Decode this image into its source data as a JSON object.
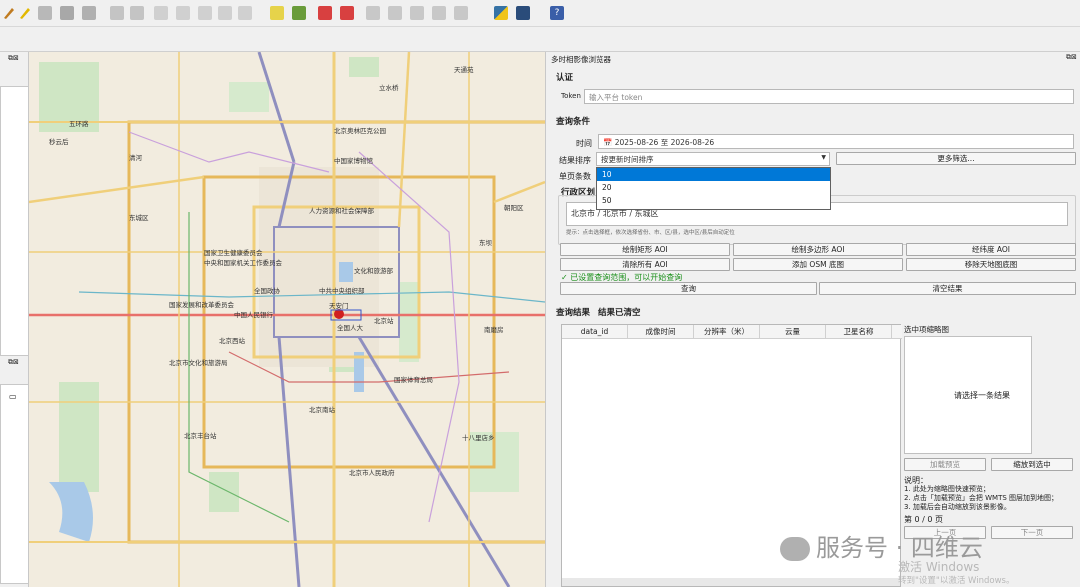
{
  "toolbar": {
    "icons": [
      "pencil-icon",
      "edit-icon",
      "save-layer-icon",
      "layers-icon",
      "vertex-tool-icon",
      "save-icon",
      "delete-icon",
      "cut-icon",
      "copy-icon",
      "paste-icon",
      "undo-icon",
      "redo-icon",
      "label-icon",
      "label-color-icon",
      "label-pin-icon",
      "label-remove-icon",
      "digitize-icon",
      "digitize2-icon",
      "digitize3-icon",
      "digitize4-icon",
      "python-icon",
      "plugin-icon",
      "help-icon"
    ]
  },
  "panel": {
    "title": "多时相影像浏览器",
    "auth": {
      "section": "认证",
      "token_label": "Token",
      "token_placeholder": "输入平台 token"
    },
    "query": {
      "section": "查询条件",
      "time_label": "时间",
      "date_from": "2025-08-26",
      "date_sep": "至",
      "date_to": "2026-08-26",
      "sort_label": "结果排序",
      "sort_value": "按更新时间排序",
      "more_filter": "更多筛选...",
      "page_size_label": "单页条数",
      "page_size_options": [
        "10",
        "20",
        "50"
      ],
      "admin_label": "行政区划",
      "admin_value": "北京市 / 北京市 / 东城区",
      "hint": "提示：点击选择框，依次选择省份、市、区/县，选中区/县后自动定位",
      "btn_draw_rect": "绘制矩形 AOI",
      "btn_draw_poly": "绘制多边形 AOI",
      "btn_latlon": "经纬度 AOI",
      "btn_clear_aoi": "清除所有 AOI",
      "btn_add_osm": "添加 OSM 底图",
      "btn_remove_map": "移除天地图底图",
      "status": "✓  已设置查询范围，可以开始查询",
      "btn_query": "查询",
      "btn_clear": "清空结果"
    },
    "results": {
      "section": "查询结果",
      "cleared": "结果已清空",
      "columns": [
        "data_id",
        "成像时间",
        "分辨率（米）",
        "云量",
        "卫星名称"
      ],
      "thumb_title": "选中项缩略图",
      "thumb_placeholder": "请选择一条结果",
      "btn_load_preview": "加载预览",
      "btn_zoom": "缩放到选中",
      "notes_title": "说明：",
      "notes": [
        "1. 此处为缩略图快速预览；",
        "2. 点击「加载预览」会把 WMTS 图层加到地图；",
        "3. 加载后会自动缩放到该景影像。"
      ],
      "page_info": "第 0 / 0 页",
      "btn_prev": "上一页",
      "btn_next": "下一页"
    }
  },
  "map": {
    "labels": [
      "五环路",
      "朝阳区",
      "秒云后",
      "立水桥",
      "天通苑",
      "北京奥林匹克公园",
      "中国家博物馆",
      "人力资源和社会保障部",
      "国家卫生健康委员会",
      "中央和国家机关工作委员会",
      "全国政协",
      "文化和旅游部",
      "中共中央组织部",
      "天安门",
      "国家发展和改革委员会",
      "中国人民银行",
      "全国人大",
      "北京市文化和旅游局",
      "北京西站",
      "北京站",
      "北京南站",
      "北京丰台站",
      "十八里店乡",
      "国家体育总局",
      "东坝",
      "南磨房",
      "清河",
      "东城区",
      "北京市人民政府"
    ]
  },
  "watermark": {
    "brand": "服务号 · 四维云",
    "activate": "激活 Windows",
    "activate_sub": "转到\"设置\"以激活 Windows。"
  },
  "colors": {
    "selected": "#0078d7",
    "ok_green": "#1a8f1a"
  }
}
